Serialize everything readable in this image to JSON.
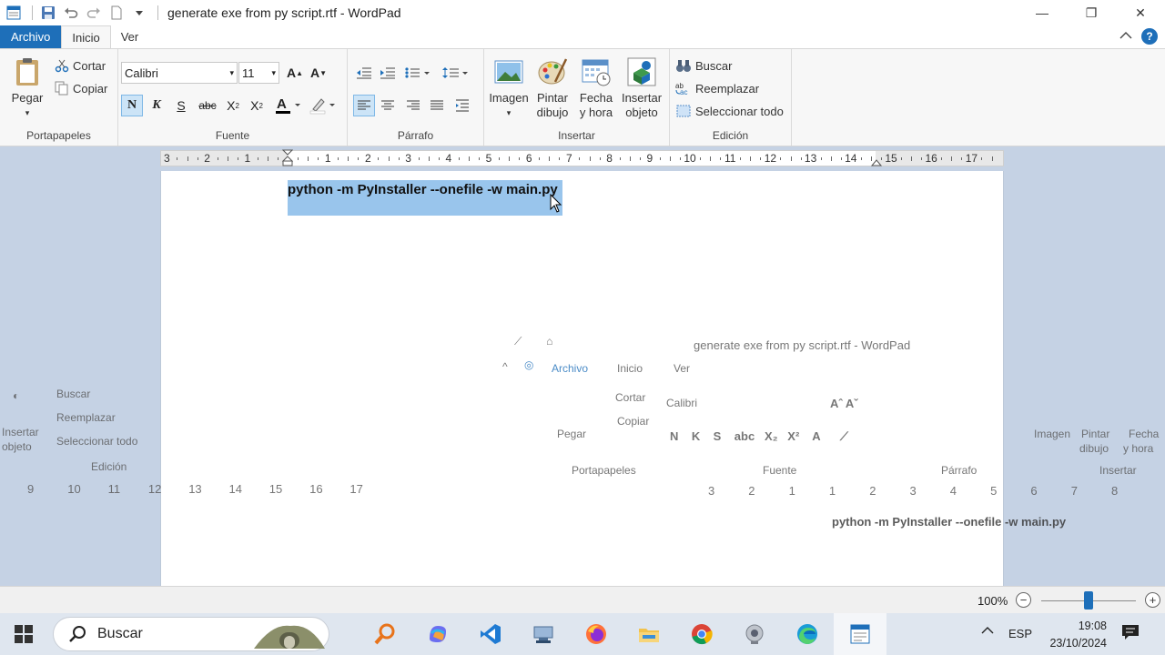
{
  "window": {
    "title": "generate exe from py script.rtf - WordPad",
    "minimize": "—",
    "maximize": "❐",
    "close": "✕"
  },
  "tabs": {
    "file": "Archivo",
    "home": "Inicio",
    "view": "Ver"
  },
  "ribbon": {
    "clipboard": {
      "label": "Portapapeles",
      "paste": "Pegar",
      "cut": "Cortar",
      "copy": "Copiar"
    },
    "font": {
      "label": "Fuente",
      "family": "Calibri",
      "size": "11",
      "bold": "N",
      "italic": "K",
      "underline": "S",
      "strike": "abc"
    },
    "paragraph": {
      "label": "Párrafo"
    },
    "insert": {
      "label": "Insertar",
      "image": "Imagen",
      "paint_1": "Pintar",
      "paint_2": "dibujo",
      "datetime_1": "Fecha",
      "datetime_2": "y hora",
      "object_1": "Insertar",
      "object_2": "objeto"
    },
    "editing": {
      "label": "Edición",
      "find": "Buscar",
      "replace": "Reemplazar",
      "select_all": "Seleccionar todo"
    }
  },
  "ruler": {
    "numbers": [
      "3",
      "2",
      "1",
      "1",
      "2",
      "3",
      "4",
      "5",
      "6",
      "7",
      "8",
      "9",
      "10",
      "11",
      "12",
      "13",
      "14",
      "15",
      "16",
      "17"
    ]
  },
  "document": {
    "line1": "python -m PyInstaller --onefile -w main.py"
  },
  "ghost": {
    "title": "generate exe from py script.rtf - WordPad",
    "file": "Archivo",
    "home": "Inicio",
    "view": "Ver",
    "find": "Buscar",
    "replace": "Reemplazar",
    "select_all": "Seleccionar todo",
    "insert_1": "Insertar",
    "insert_2": "objeto",
    "editing": "Edición",
    "cut": "Cortar",
    "copy": "Copiar",
    "paste": "Pegar",
    "clipboard": "Portapapeles",
    "font_family": "Calibri",
    "font_label": "Fuente",
    "paragraph": "Párrafo",
    "image": "Imagen",
    "paint_1": "Pintar",
    "paint_2": "dibujo",
    "datetime_1": "Fecha",
    "datetime_2": "y hora",
    "insert_label": "Insertar",
    "line1": "python -m PyInstaller --onefile -w main.py",
    "ruler_left": [
      "9",
      "10",
      "11",
      "12",
      "13",
      "14",
      "15",
      "16",
      "17"
    ],
    "ruler_right": [
      "3",
      "2",
      "1",
      "1",
      "2",
      "3",
      "4",
      "5",
      "6",
      "7",
      "8"
    ]
  },
  "status": {
    "zoom": "100%",
    "zoom_level": 0.5
  },
  "taskbar": {
    "search": "Buscar",
    "language": "ESP",
    "time": "19:08",
    "date": "23/10/2024"
  },
  "colors": {
    "accent": "#1e6fb9",
    "selection": "#99c5ec",
    "workspace": "#c5d2e4"
  }
}
